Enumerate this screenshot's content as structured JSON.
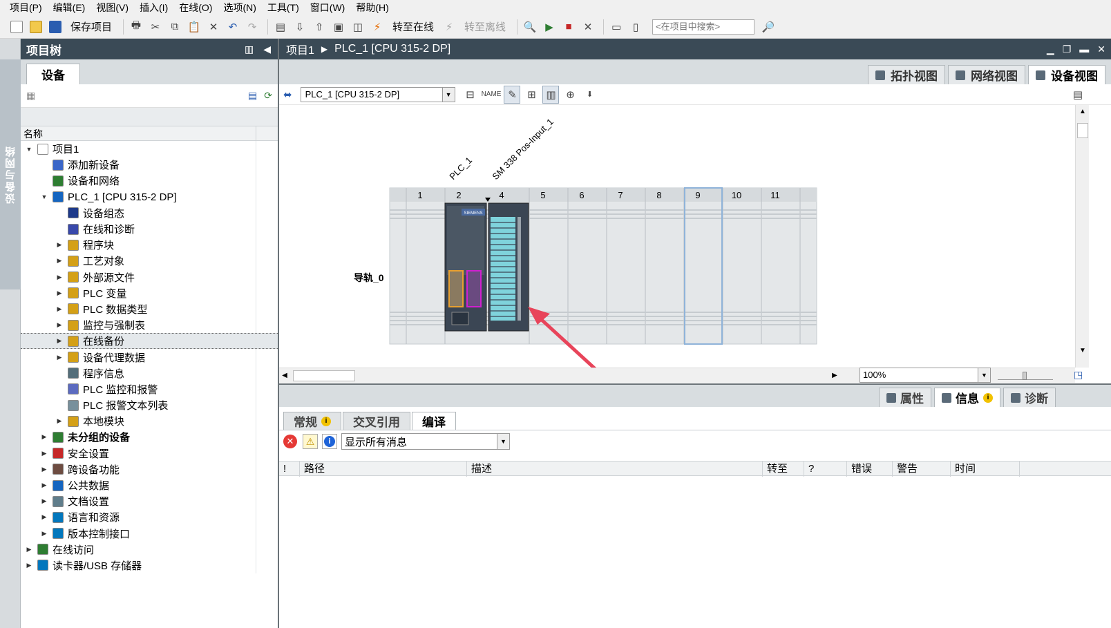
{
  "menu": [
    "项目(P)",
    "编辑(E)",
    "视图(V)",
    "插入(I)",
    "在线(O)",
    "选项(N)",
    "工具(T)",
    "窗口(W)",
    "帮助(H)"
  ],
  "toolbar": {
    "save_label": "保存项目",
    "go_online": "转至在线",
    "go_offline": "转至离线",
    "search_placeholder": "<在项目中搜索>"
  },
  "sidestrip": {
    "label": "设备与网络"
  },
  "project_tree": {
    "title": "项目树",
    "tab": "设备",
    "column_header": "名称",
    "items": [
      {
        "label": "项目1",
        "indent": 0,
        "twisty": "open",
        "icon": "project-icon",
        "color": "#ffffff"
      },
      {
        "label": "添加新设备",
        "indent": 1,
        "twisty": "",
        "icon": "add-device-icon",
        "color": "#3a66c8"
      },
      {
        "label": "设备和网络",
        "indent": 1,
        "twisty": "",
        "icon": "network-icon",
        "color": "#2e7d32"
      },
      {
        "label": "PLC_1 [CPU 315-2 DP]",
        "indent": 1,
        "twisty": "open",
        "icon": "plc-icon",
        "color": "#1565c0"
      },
      {
        "label": "设备组态",
        "indent": 2,
        "twisty": "",
        "icon": "device-config-icon",
        "color": "#1e3a8a"
      },
      {
        "label": "在线和诊断",
        "indent": 2,
        "twisty": "",
        "icon": "diagnostics-icon",
        "color": "#3949ab"
      },
      {
        "label": "程序块",
        "indent": 2,
        "twisty": "closed",
        "icon": "folder-icon",
        "color": "#d4a017"
      },
      {
        "label": "工艺对象",
        "indent": 2,
        "twisty": "closed",
        "icon": "folder-icon",
        "color": "#d4a017"
      },
      {
        "label": "外部源文件",
        "indent": 2,
        "twisty": "closed",
        "icon": "folder-icon",
        "color": "#d4a017"
      },
      {
        "label": "PLC 变量",
        "indent": 2,
        "twisty": "closed",
        "icon": "folder-icon",
        "color": "#d4a017"
      },
      {
        "label": "PLC 数据类型",
        "indent": 2,
        "twisty": "closed",
        "icon": "folder-icon",
        "color": "#d4a017"
      },
      {
        "label": "监控与强制表",
        "indent": 2,
        "twisty": "closed",
        "icon": "folder-icon",
        "color": "#d4a017"
      },
      {
        "label": "在线备份",
        "indent": 2,
        "twisty": "closed",
        "icon": "folder-icon",
        "color": "#d4a017",
        "selected": true
      },
      {
        "label": "设备代理数据",
        "indent": 2,
        "twisty": "closed",
        "icon": "folder-icon",
        "color": "#d4a017"
      },
      {
        "label": "程序信息",
        "indent": 2,
        "twisty": "",
        "icon": "program-info-icon",
        "color": "#546e7a"
      },
      {
        "label": "PLC 监控和报警",
        "indent": 2,
        "twisty": "",
        "icon": "alarm-icon",
        "color": "#5c6bc0"
      },
      {
        "label": "PLC 报警文本列表",
        "indent": 2,
        "twisty": "",
        "icon": "text-list-icon",
        "color": "#78909c"
      },
      {
        "label": "本地模块",
        "indent": 2,
        "twisty": "closed",
        "icon": "folder-icon",
        "color": "#d4a017"
      },
      {
        "label": "未分组的设备",
        "indent": 1,
        "twisty": "closed",
        "icon": "ungrouped-icon",
        "color": "#2e7d32",
        "bold": true
      },
      {
        "label": "安全设置",
        "indent": 1,
        "twisty": "closed",
        "icon": "security-icon",
        "color": "#c62828"
      },
      {
        "label": "跨设备功能",
        "indent": 1,
        "twisty": "closed",
        "icon": "cross-device-icon",
        "color": "#6d4c41"
      },
      {
        "label": "公共数据",
        "indent": 1,
        "twisty": "closed",
        "icon": "common-data-icon",
        "color": "#1565c0"
      },
      {
        "label": "文档设置",
        "indent": 1,
        "twisty": "closed",
        "icon": "document-icon",
        "color": "#607d8b"
      },
      {
        "label": "语言和资源",
        "indent": 1,
        "twisty": "closed",
        "icon": "language-icon",
        "color": "#0277bd"
      },
      {
        "label": "版本控制接口",
        "indent": 1,
        "twisty": "closed",
        "icon": "version-icon",
        "color": "#0277bd"
      },
      {
        "label": "在线访问",
        "indent": 0,
        "twisty": "closed",
        "icon": "online-access-icon",
        "color": "#2e7d32"
      },
      {
        "label": "读卡器/USB 存储器",
        "indent": 0,
        "twisty": "closed",
        "icon": "usb-icon",
        "color": "#0277bd"
      }
    ]
  },
  "editor": {
    "breadcrumb_project": "项目1",
    "breadcrumb_device": "PLC_1 [CPU 315-2 DP]",
    "view_tabs": [
      {
        "label": "拓扑视图",
        "icon": "topology-icon",
        "active": false
      },
      {
        "label": "网络视图",
        "icon": "network-view-icon",
        "active": false
      },
      {
        "label": "设备视图",
        "icon": "device-view-icon",
        "active": true
      }
    ],
    "device_select": "PLC_1 [CPU 315-2 DP]",
    "zoom": "100%",
    "rail_label": "导轨_0",
    "module_labels": [
      "PLC_1",
      "SM 338 Pos-Input_1"
    ],
    "slots": [
      "1",
      "2",
      "4",
      "5",
      "6",
      "7",
      "8",
      "9",
      "10",
      "11"
    ],
    "cpu_brand": "SIEMENS"
  },
  "inspector": {
    "tabs": [
      {
        "label": "属性",
        "icon": "properties-icon",
        "active": false,
        "info": false
      },
      {
        "label": "信息",
        "icon": "info-icon",
        "active": true,
        "info": true
      },
      {
        "label": "诊断",
        "icon": "diagnostics-icon",
        "active": false,
        "info": false
      }
    ],
    "sub_tabs": [
      {
        "label": "常规",
        "active": false,
        "info": true
      },
      {
        "label": "交叉引用",
        "active": false,
        "info": false
      },
      {
        "label": "编译",
        "active": true,
        "info": false
      }
    ],
    "filter": "显示所有消息",
    "columns": [
      "!",
      "路径",
      "描述",
      "转至",
      "?",
      "错误",
      "警告",
      "时间"
    ]
  },
  "colors": {
    "title_bar": "#3a4a56",
    "panel_bg": "#d8dde0",
    "arrow": "#e8445a",
    "cpu_module": "#3b4654",
    "io_module": "#7fd3dc"
  }
}
